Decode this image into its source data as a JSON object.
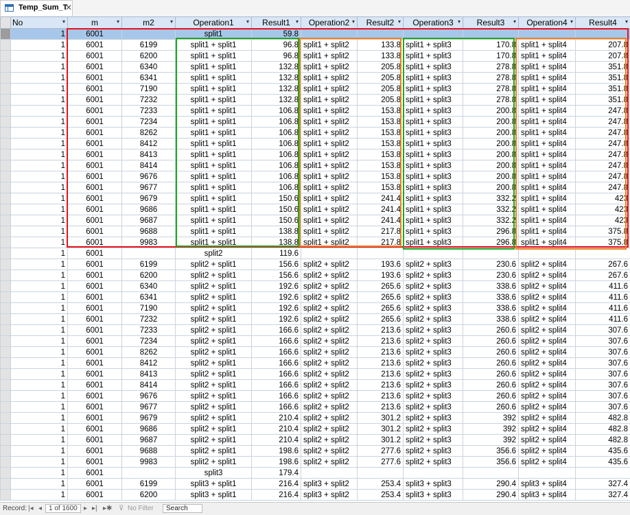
{
  "tab": {
    "title": "Temp_Sum_T",
    "close": "✕"
  },
  "columns": [
    "No",
    "m",
    "m2",
    "Operation1",
    "Result1",
    "Operation2",
    "Result2",
    "Operation3",
    "Result3",
    "Operation4",
    "Result4"
  ],
  "rows": [
    [
      "1",
      "6001",
      "",
      "split1",
      "59.8",
      "",
      "",
      "",
      "",
      "",
      ""
    ],
    [
      "1",
      "6001",
      "6199",
      "split1 + split1",
      "96.8",
      "split1 + split2",
      "133.8",
      "split1 + split3",
      "170.8",
      "split1 + split4",
      "207.8"
    ],
    [
      "1",
      "6001",
      "6200",
      "split1 + split1",
      "96.8",
      "split1 + split2",
      "133.8",
      "split1 + split3",
      "170.8",
      "split1 + split4",
      "207.8"
    ],
    [
      "1",
      "6001",
      "6340",
      "split1 + split1",
      "132.8",
      "split1 + split2",
      "205.8",
      "split1 + split3",
      "278.8",
      "split1 + split4",
      "351.8"
    ],
    [
      "1",
      "6001",
      "6341",
      "split1 + split1",
      "132.8",
      "split1 + split2",
      "205.8",
      "split1 + split3",
      "278.8",
      "split1 + split4",
      "351.8"
    ],
    [
      "1",
      "6001",
      "7190",
      "split1 + split1",
      "132.8",
      "split1 + split2",
      "205.8",
      "split1 + split3",
      "278.8",
      "split1 + split4",
      "351.8"
    ],
    [
      "1",
      "6001",
      "7232",
      "split1 + split1",
      "132.8",
      "split1 + split2",
      "205.8",
      "split1 + split3",
      "278.8",
      "split1 + split4",
      "351.8"
    ],
    [
      "1",
      "6001",
      "7233",
      "split1 + split1",
      "106.8",
      "split1 + split2",
      "153.8",
      "split1 + split3",
      "200.8",
      "split1 + split4",
      "247.8"
    ],
    [
      "1",
      "6001",
      "7234",
      "split1 + split1",
      "106.8",
      "split1 + split2",
      "153.8",
      "split1 + split3",
      "200.8",
      "split1 + split4",
      "247.8"
    ],
    [
      "1",
      "6001",
      "8262",
      "split1 + split1",
      "106.8",
      "split1 + split2",
      "153.8",
      "split1 + split3",
      "200.8",
      "split1 + split4",
      "247.8"
    ],
    [
      "1",
      "6001",
      "8412",
      "split1 + split1",
      "106.8",
      "split1 + split2",
      "153.8",
      "split1 + split3",
      "200.8",
      "split1 + split4",
      "247.8"
    ],
    [
      "1",
      "6001",
      "8413",
      "split1 + split1",
      "106.8",
      "split1 + split2",
      "153.8",
      "split1 + split3",
      "200.8",
      "split1 + split4",
      "247.8"
    ],
    [
      "1",
      "6001",
      "8414",
      "split1 + split1",
      "106.8",
      "split1 + split2",
      "153.8",
      "split1 + split3",
      "200.8",
      "split1 + split4",
      "247.8"
    ],
    [
      "1",
      "6001",
      "9676",
      "split1 + split1",
      "106.8",
      "split1 + split2",
      "153.8",
      "split1 + split3",
      "200.8",
      "split1 + split4",
      "247.8"
    ],
    [
      "1",
      "6001",
      "9677",
      "split1 + split1",
      "106.8",
      "split1 + split2",
      "153.8",
      "split1 + split3",
      "200.8",
      "split1 + split4",
      "247.8"
    ],
    [
      "1",
      "6001",
      "9679",
      "split1 + split1",
      "150.6",
      "split1 + split2",
      "241.4",
      "split1 + split3",
      "332.2",
      "split1 + split4",
      "423"
    ],
    [
      "1",
      "6001",
      "9686",
      "split1 + split1",
      "150.6",
      "split1 + split2",
      "241.4",
      "split1 + split3",
      "332.2",
      "split1 + split4",
      "423"
    ],
    [
      "1",
      "6001",
      "9687",
      "split1 + split1",
      "150.6",
      "split1 + split2",
      "241.4",
      "split1 + split3",
      "332.2",
      "split1 + split4",
      "423"
    ],
    [
      "1",
      "6001",
      "9688",
      "split1 + split1",
      "138.8",
      "split1 + split2",
      "217.8",
      "split1 + split3",
      "296.8",
      "split1 + split4",
      "375.8"
    ],
    [
      "1",
      "6001",
      "9983",
      "split1 + split1",
      "138.8",
      "split1 + split2",
      "217.8",
      "split1 + split3",
      "296.8",
      "split1 + split4",
      "375.8"
    ],
    [
      "1",
      "6001",
      "",
      "split2",
      "119.6",
      "",
      "",
      "",
      "",
      "",
      ""
    ],
    [
      "1",
      "6001",
      "6199",
      "split2 + split1",
      "156.6",
      "split2 + split2",
      "193.6",
      "split2 + split3",
      "230.6",
      "split2 + split4",
      "267.6"
    ],
    [
      "1",
      "6001",
      "6200",
      "split2 + split1",
      "156.6",
      "split2 + split2",
      "193.6",
      "split2 + split3",
      "230.6",
      "split2 + split4",
      "267.6"
    ],
    [
      "1",
      "6001",
      "6340",
      "split2 + split1",
      "192.6",
      "split2 + split2",
      "265.6",
      "split2 + split3",
      "338.6",
      "split2 + split4",
      "411.6"
    ],
    [
      "1",
      "6001",
      "6341",
      "split2 + split1",
      "192.6",
      "split2 + split2",
      "265.6",
      "split2 + split3",
      "338.6",
      "split2 + split4",
      "411.6"
    ],
    [
      "1",
      "6001",
      "7190",
      "split2 + split1",
      "192.6",
      "split2 + split2",
      "265.6",
      "split2 + split3",
      "338.6",
      "split2 + split4",
      "411.6"
    ],
    [
      "1",
      "6001",
      "7232",
      "split2 + split1",
      "192.6",
      "split2 + split2",
      "265.6",
      "split2 + split3",
      "338.6",
      "split2 + split4",
      "411.6"
    ],
    [
      "1",
      "6001",
      "7233",
      "split2 + split1",
      "166.6",
      "split2 + split2",
      "213.6",
      "split2 + split3",
      "260.6",
      "split2 + split4",
      "307.6"
    ],
    [
      "1",
      "6001",
      "7234",
      "split2 + split1",
      "166.6",
      "split2 + split2",
      "213.6",
      "split2 + split3",
      "260.6",
      "split2 + split4",
      "307.6"
    ],
    [
      "1",
      "6001",
      "8262",
      "split2 + split1",
      "166.6",
      "split2 + split2",
      "213.6",
      "split2 + split3",
      "260.6",
      "split2 + split4",
      "307.6"
    ],
    [
      "1",
      "6001",
      "8412",
      "split2 + split1",
      "166.6",
      "split2 + split2",
      "213.6",
      "split2 + split3",
      "260.6",
      "split2 + split4",
      "307.6"
    ],
    [
      "1",
      "6001",
      "8413",
      "split2 + split1",
      "166.6",
      "split2 + split2",
      "213.6",
      "split2 + split3",
      "260.6",
      "split2 + split4",
      "307.6"
    ],
    [
      "1",
      "6001",
      "8414",
      "split2 + split1",
      "166.6",
      "split2 + split2",
      "213.6",
      "split2 + split3",
      "260.6",
      "split2 + split4",
      "307.6"
    ],
    [
      "1",
      "6001",
      "9676",
      "split2 + split1",
      "166.6",
      "split2 + split2",
      "213.6",
      "split2 + split3",
      "260.6",
      "split2 + split4",
      "307.6"
    ],
    [
      "1",
      "6001",
      "9677",
      "split2 + split1",
      "166.6",
      "split2 + split2",
      "213.6",
      "split2 + split3",
      "260.6",
      "split2 + split4",
      "307.6"
    ],
    [
      "1",
      "6001",
      "9679",
      "split2 + split1",
      "210.4",
      "split2 + split2",
      "301.2",
      "split2 + split3",
      "392",
      "split2 + split4",
      "482.8"
    ],
    [
      "1",
      "6001",
      "9686",
      "split2 + split1",
      "210.4",
      "split2 + split2",
      "301.2",
      "split2 + split3",
      "392",
      "split2 + split4",
      "482.8"
    ],
    [
      "1",
      "6001",
      "9687",
      "split2 + split1",
      "210.4",
      "split2 + split2",
      "301.2",
      "split2 + split3",
      "392",
      "split2 + split4",
      "482.8"
    ],
    [
      "1",
      "6001",
      "9688",
      "split2 + split1",
      "198.6",
      "split2 + split2",
      "277.6",
      "split2 + split3",
      "356.6",
      "split2 + split4",
      "435.6"
    ],
    [
      "1",
      "6001",
      "9983",
      "split2 + split1",
      "198.6",
      "split2 + split2",
      "277.6",
      "split2 + split3",
      "356.6",
      "split2 + split4",
      "435.6"
    ],
    [
      "1",
      "6001",
      "",
      "split3",
      "179.4",
      "",
      "",
      "",
      "",
      "",
      ""
    ],
    [
      "1",
      "6001",
      "6199",
      "split3 + split1",
      "216.4",
      "split3 + split2",
      "253.4",
      "split3 + split3",
      "290.4",
      "split3 + split4",
      "327.4"
    ],
    [
      "1",
      "6001",
      "6200",
      "split3 + split1",
      "216.4",
      "split3 + split2",
      "253.4",
      "split3 + split3",
      "290.4",
      "split3 + split4",
      "327.4"
    ]
  ],
  "highlight_colors": {
    "red": "#e8101a",
    "green": "#1fa81f",
    "orange": "#f07f1d"
  },
  "status": {
    "label": "Record:",
    "first": "|◂",
    "prev": "◂",
    "position": "1 of 1600",
    "next": "▸",
    "last": "▸|",
    "new": "▸✱",
    "filter": "No Filter",
    "search": "Search"
  }
}
